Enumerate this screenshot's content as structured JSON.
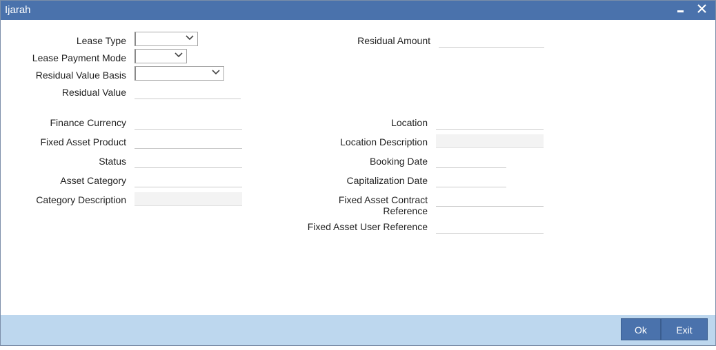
{
  "window": {
    "title": "Ijarah",
    "minimize_symbol": "▬",
    "close_symbol": "✕"
  },
  "left_fields": {
    "lease_type": {
      "label": "Lease Type",
      "value": ""
    },
    "lease_payment_mode": {
      "label": "Lease Payment Mode",
      "value": ""
    },
    "residual_value_basis": {
      "label": "Residual Value Basis",
      "value": ""
    },
    "residual_value": {
      "label": "Residual Value",
      "value": ""
    },
    "finance_currency": {
      "label": "Finance Currency",
      "value": ""
    },
    "fixed_asset_product": {
      "label": "Fixed Asset Product",
      "value": ""
    },
    "status": {
      "label": "Status",
      "value": ""
    },
    "asset_category": {
      "label": "Asset Category",
      "value": ""
    },
    "category_description": {
      "label": "Category Description",
      "value": ""
    }
  },
  "right_fields": {
    "residual_amount": {
      "label": "Residual Amount",
      "value": ""
    },
    "location": {
      "label": "Location",
      "value": ""
    },
    "location_description": {
      "label": "Location Description",
      "value": ""
    },
    "booking_date": {
      "label": "Booking Date",
      "value": ""
    },
    "capitalization_date": {
      "label": "Capitalization Date",
      "value": ""
    },
    "fixed_asset_contract_reference": {
      "label_line1": "Fixed Asset Contract",
      "label_line2": "Reference",
      "value": ""
    },
    "fixed_asset_user_reference": {
      "label": "Fixed Asset User Reference",
      "value": ""
    }
  },
  "footer": {
    "ok_label": "Ok",
    "exit_label": "Exit"
  },
  "colors": {
    "titlebar": "#4a72ac",
    "footer": "#bdd7ee",
    "button": "#4a72ac"
  },
  "icons": {
    "dropdown": "chevron-down-icon",
    "minimize": "minimize-icon",
    "close": "close-icon"
  }
}
